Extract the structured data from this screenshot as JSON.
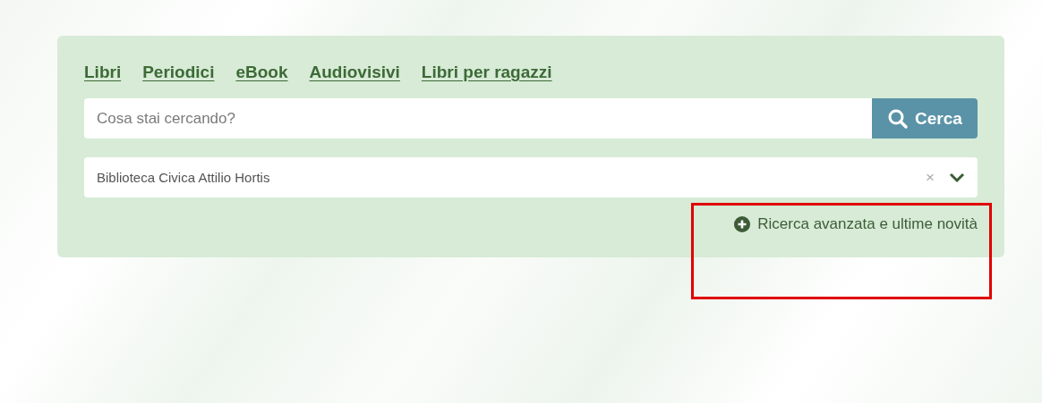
{
  "tabs": [
    {
      "label": "Libri"
    },
    {
      "label": "Periodici"
    },
    {
      "label": "eBook"
    },
    {
      "label": "Audiovisivi"
    },
    {
      "label": "Libri per ragazzi"
    }
  ],
  "search": {
    "placeholder": "Cosa stai cercando?",
    "button": "Cerca"
  },
  "library_select": {
    "value": "Biblioteca Civica Attilio Hortis",
    "clear": "×"
  },
  "advanced_link": {
    "label": "Ricerca avanzata e ultime novità"
  },
  "annotation": {
    "kind": "highlight"
  }
}
